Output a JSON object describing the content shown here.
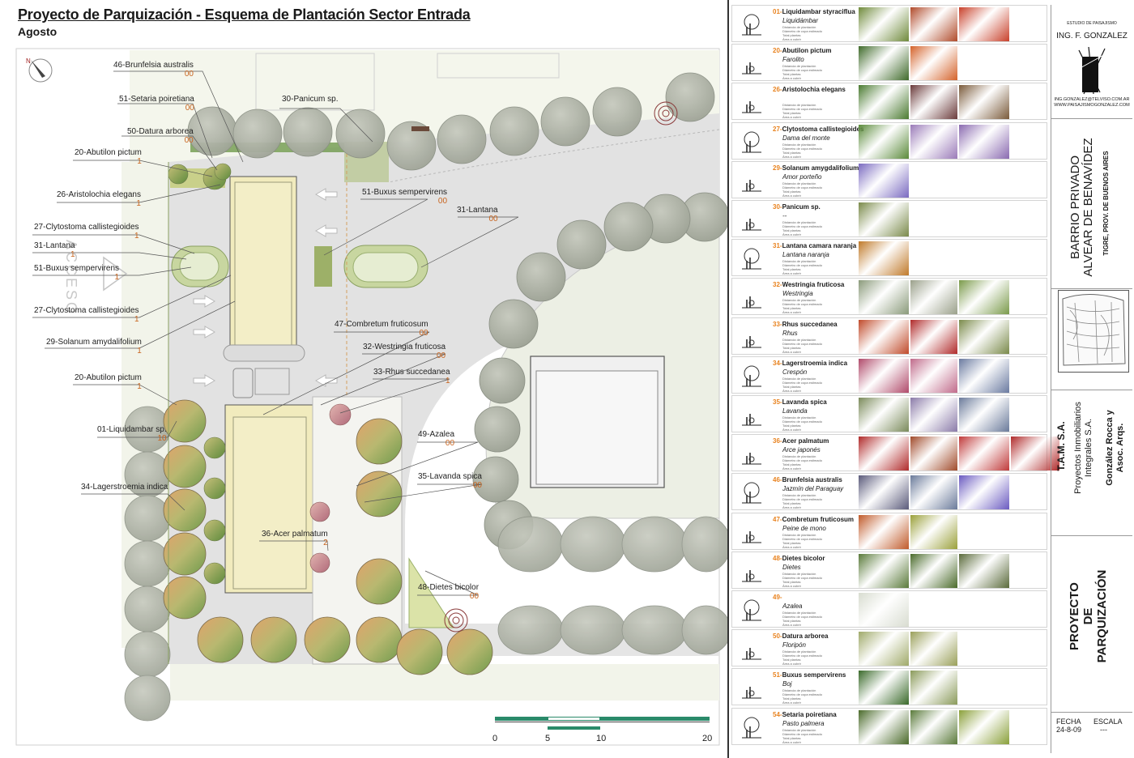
{
  "header": {
    "title": "Proyecto de Parquización - Esquema de Plantación Sector Entrada",
    "subtitle": "Agosto"
  },
  "plan": {
    "acceso_label": "ACCESO",
    "labels": [
      {
        "text": "46-Brunfelsia australis",
        "count": "00"
      },
      {
        "text": "51-Setaria poiretiana",
        "count": "00"
      },
      {
        "text": "50-Datura arborea",
        "count": "00"
      },
      {
        "text": "20-Abutilon pictum",
        "count": "1"
      },
      {
        "text": "26-Aristolochia elegans",
        "count": "1"
      },
      {
        "text": "27-Clytostoma callistegioides",
        "count": "1"
      },
      {
        "text": "31-Lantana",
        "count": "1"
      },
      {
        "text": "51-Buxus sempervirens",
        "count": "1"
      },
      {
        "text": "27-Clytostoma callistegioides",
        "count": "1"
      },
      {
        "text": "29-Solanum amydalifolium",
        "count": "1"
      },
      {
        "text": "20-Abutilon pictum",
        "count": "1"
      },
      {
        "text": "01-Liquidambar sp.",
        "count": "10"
      },
      {
        "text": "34-Lagerstroemia indica",
        "count": ""
      },
      {
        "text": "30-Panicum sp.",
        "count": ""
      },
      {
        "text": "51-Buxus sempervirens",
        "count": "00"
      },
      {
        "text": "31-Lantana",
        "count": "00"
      },
      {
        "text": "47-Combretum fruticosum",
        "count": "00"
      },
      {
        "text": "32-Westringia fruticosa",
        "count": "00"
      },
      {
        "text": "33-Rhus succedanea",
        "count": "1"
      },
      {
        "text": "49-Azalea",
        "count": "00"
      },
      {
        "text": "35-Lavanda spica",
        "count": "00"
      },
      {
        "text": "36-Acer palmatum",
        "count": "2"
      },
      {
        "text": "48-Dietes bicolor",
        "count": "00"
      }
    ],
    "scale_ticks": [
      "0",
      "5",
      "10",
      "20"
    ]
  },
  "plants": [
    {
      "num": "01",
      "name": "Liquidambar styraciflua",
      "common": "Liquidámbar",
      "photos": [
        "#6f8a3b",
        "#b04a2a",
        "#c8402a"
      ]
    },
    {
      "num": "20",
      "name": "Abutilon pictum",
      "common": "Farolito",
      "photos": [
        "#3f6a2a",
        "#d4622a"
      ]
    },
    {
      "num": "26",
      "name": "Aristolochia elegans",
      "common": "",
      "photos": [
        "#4a7a30",
        "#6a3a3a",
        "#7a5a3a"
      ]
    },
    {
      "num": "27",
      "name": "Clytostoma callistegioides",
      "common": "Dama del monte",
      "photos": [
        "#5a8a3a",
        "#9a7ab8",
        "#8a6ab0"
      ]
    },
    {
      "num": "29",
      "name": "Solanum amygdalifolium",
      "common": "Amor porteño",
      "photos": [
        "#7a6ac0"
      ]
    },
    {
      "num": "30",
      "name": "Panicum sp.",
      "common": "--",
      "photos": [
        "#7a8a4a"
      ]
    },
    {
      "num": "31",
      "name": "Lantana camara naranja",
      "common": "Lantana naranja",
      "photos": [
        "#c07a2a"
      ]
    },
    {
      "num": "32",
      "name": "Westringia fruticosa",
      "common": "Westringia",
      "photos": [
        "#8a9a7a",
        "#9aa08a",
        "#7a9a4a"
      ]
    },
    {
      "num": "33",
      "name": "Rhus succedanea",
      "common": "Rhus",
      "photos": [
        "#c04a2a",
        "#b02a2a",
        "#7a8a4a"
      ]
    },
    {
      "num": "34",
      "name": "Lagerstroemia indica",
      "common": "Crespón",
      "photos": [
        "#b04a6a",
        "#c06a8a",
        "#6a7aa0"
      ]
    },
    {
      "num": "35",
      "name": "Lavanda spica",
      "common": "Lavanda",
      "photos": [
        "#7a8a5a",
        "#8a7aa8",
        "#6a7a9a"
      ]
    },
    {
      "num": "36",
      "name": "Acer palmatum",
      "common": "Arce japonés",
      "photos": [
        "#b02a2a",
        "#a04a2a",
        "#c03a3a",
        "#b02a2a"
      ]
    },
    {
      "num": "46",
      "name": "Brunfelsia australis",
      "common": "Jazmín del Paraguay",
      "photos": [
        "#5a5a7a",
        "#6a7a9a",
        "#6a5ac0"
      ]
    },
    {
      "num": "47",
      "name": "Combretum fruticosum",
      "common": "Peine de mono",
      "photos": [
        "#c05a2a",
        "#9aa03a"
      ]
    },
    {
      "num": "48",
      "name": "Dietes bicolor",
      "common": "Dietes",
      "photos": [
        "#5a7a3a",
        "#4a6a2a",
        "#5a6a3a"
      ]
    },
    {
      "num": "49",
      "name": "",
      "common": "Azalea",
      "photos": [
        "#d8dcd0"
      ]
    },
    {
      "num": "50",
      "name": "Datura arborea",
      "common": "Floripón",
      "photos": [
        "#a0aa6a",
        "#9aa05a"
      ]
    },
    {
      "num": "51",
      "name": "Buxus sempervirens",
      "common": "Boj",
      "photos": [
        "#3a6a2a",
        "#8a9a5a"
      ]
    },
    {
      "num": "54",
      "name": "Setaria poiretiana",
      "common": "Pasto palmera",
      "photos": [
        "#4a6a2a",
        "#5a7a3a",
        "#8aa03a"
      ]
    }
  ],
  "plant_details": [
    "Distancia de plantación",
    "Diámetro de copa estimado",
    "Total plantas",
    "Área a cubrir"
  ],
  "titleblock": {
    "studio": "ESTUDIO DE PAISAJISMO",
    "engineer": "ING. F. GONZALEZ",
    "email": "ING.GONZALEZ@TELVISO.COM.AR",
    "web": "WWW.PAISAJISMOGONZALEZ.COM",
    "barrio1": "BARRIO PRIVADO",
    "barrio2": "ALVEAR DE BENAVÍDEZ",
    "location": "TIGRE, PROV. DE BUENOS AIRES",
    "client1": "T.A.M. S.A.",
    "client2": "Proyectos Inmobiliarios",
    "client3": "Integrales S.A.",
    "client4": "González Rocca y",
    "client5": "Asoc. Arqs.",
    "project1": "PROYECTO",
    "project2": "DE",
    "project3": "PARQUIZACIÓN",
    "fecha_label": "FECHA",
    "fecha_value": "24-8-09",
    "escala_label": "ESCALA",
    "escala_value": "---"
  }
}
